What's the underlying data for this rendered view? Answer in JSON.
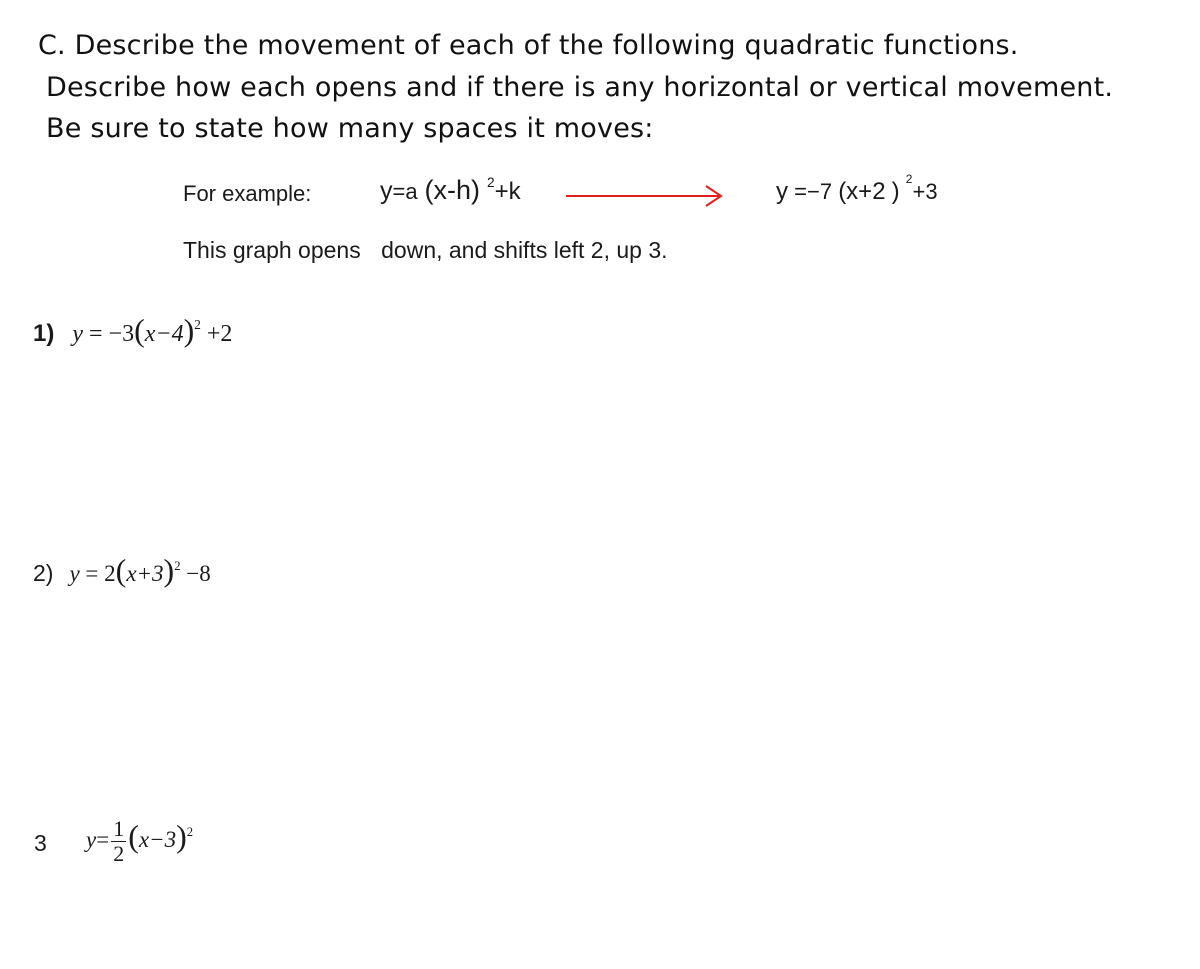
{
  "instructions": {
    "line1": "C. Describe the movement of each of the following quadratic functions.",
    "line2": "Describe how each opens and if there is any horizontal or vertical movement.",
    "line3": "Be sure to state how many spaces it moves:"
  },
  "example": {
    "label": "For example:",
    "general_form": {
      "lhs": "y",
      "eq": "=a",
      "paren": "(x-h)",
      "exp": "2",
      "tail": "+k"
    },
    "arrow_color": "#e02020",
    "specific_form": {
      "lhs": "y",
      "eq": "=−7",
      "paren_open": "(x+2",
      "paren_close": ")",
      "exp": "2",
      "tail": "+3"
    },
    "explanation_prefix": "This graph opens",
    "explanation_answer": "down, and shifts left 2, up 3."
  },
  "problems": [
    {
      "number": "1)",
      "lhs": "y",
      "eq": "=",
      "coef": "−3",
      "inner": "x−4",
      "exp": "2",
      "tail": "+2"
    },
    {
      "number": "2)",
      "lhs": "y",
      "eq": "=",
      "coef": "2",
      "inner": "x+3",
      "exp": "2",
      "tail": "−8"
    },
    {
      "number": "3",
      "lhs": "y",
      "eq": "=",
      "frac_num": "1",
      "frac_den": "2",
      "inner": "x−3",
      "exp": "2"
    }
  ]
}
